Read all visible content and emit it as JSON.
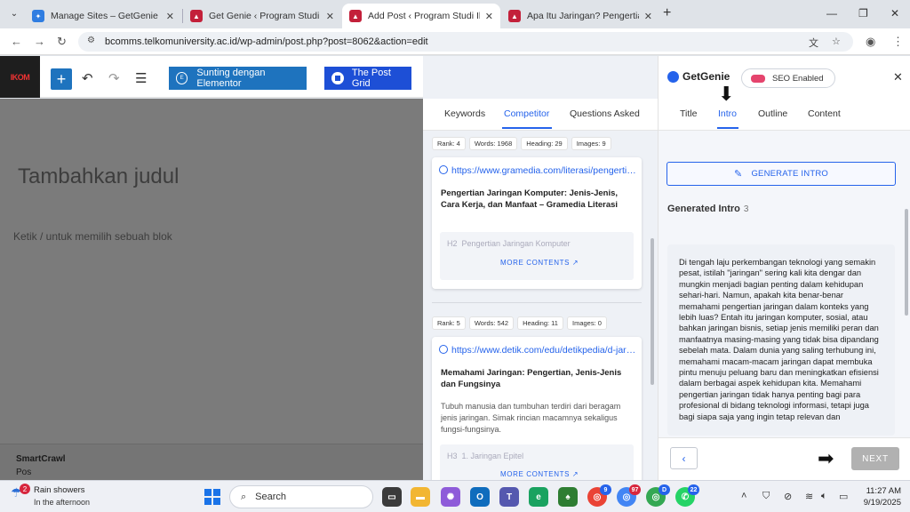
{
  "browser": {
    "tabs": [
      {
        "title": "Manage Sites – GetGenie",
        "icon": "getgenie-favicon"
      },
      {
        "title": "Get Genie ‹ Program Studi Ilmu",
        "icon": "telkom-favicon"
      },
      {
        "title": "Add Post ‹ Program Studi Ilmu",
        "icon": "telkom-favicon"
      },
      {
        "title": "Apa Itu Jaringan? Pengertian, Je",
        "icon": "telkom-favicon"
      }
    ],
    "url": "bcomms.telkomuniversity.ac.id/wp-admin/post.php?post=8062&action=edit"
  },
  "wp_toolbar": {
    "logo_text": "IKOM",
    "add_label": "+",
    "elementor_label": "Sunting dengan Elementor",
    "postgrid_label": "The Post Grid"
  },
  "editor": {
    "title_placeholder": "Tambahkan judul",
    "block_hint": "Ketik / untuk memilih sebuah blok",
    "footer_title": "SmartCrawl",
    "footer_sub": "Pos"
  },
  "competitor_panel": {
    "tabs": [
      "Keywords",
      "Competitor",
      "Questions Asked"
    ],
    "active_tab": "Competitor",
    "results": [
      {
        "stats": [
          "Rank: 4",
          "Words: 1968",
          "Heading: 29",
          "Images: 9"
        ],
        "url": "https://www.gramedia.com/literasi/pengertian-jaringan-komputer/",
        "title": "Pengertian Jaringan Komputer: Jenis-Jenis, Cara Kerja, dan Manfaat – Gramedia Literasi",
        "description": "",
        "heading_tag": "H2",
        "heading": "Pengertian Jaringan Komputer",
        "more": "MORE CONTENTS ↗"
      },
      {
        "stats": [
          "Rank: 5",
          "Words: 542",
          "Heading: 11",
          "Images: 0"
        ],
        "url": "https://www.detik.com/edu/detikpedia/d-jaringan",
        "title": "Memahami Jaringan: Pengertian, Jenis-Jenis dan Fungsinya",
        "description": "Tubuh manusia dan tumbuhan terdiri dari beragam jenis jaringan. Simak rincian macamnya sekaligus fungsi-fungsinya.",
        "heading_tag": "H3",
        "heading": "1. Jaringan Epitel",
        "more": "MORE CONTENTS ↗"
      }
    ]
  },
  "genie_panel": {
    "brand": "GetGenie",
    "seo_label": "SEO Enabled",
    "tabs": [
      "Title",
      "Intro",
      "Outline",
      "Content"
    ],
    "active_tab": "Intro",
    "generate_label": "GENERATE INTRO",
    "generated_heading": "Generated Intro",
    "generated_count": "3",
    "intro_text": "Di tengah laju perkembangan teknologi yang semakin pesat, istilah \"jaringan\" sering kali kita dengar dan mungkin menjadi bagian penting dalam kehidupan sehari-hari. Namun, apakah kita benar-benar memahami pengertian jaringan dalam konteks yang lebih luas? Entah itu jaringan komputer, sosial, atau bahkan jaringan bisnis, setiap jenis memiliki peran dan manfaatnya masing-masing yang tidak bisa dipandang sebelah mata. Dalam dunia yang saling terhubung ini, memahami macam-macam jaringan dapat membuka pintu menuju peluang baru dan meningkatkan efisiensi dalam berbagai aspek kehidupan kita. Memahami pengertian jaringan tidak hanya penting bagi para profesional di bidang teknologi informasi, tetapi juga bagi siapa saja yang ingin tetap relevan dan",
    "next_label": "NEXT",
    "back_icon": "chevron-left-icon"
  },
  "taskbar": {
    "weather_title": "Rain showers",
    "weather_sub": "In the afternoon",
    "weather_badge": "2",
    "search_placeholder": "Search",
    "apps": [
      {
        "name": "chrome-1",
        "badge": "9"
      },
      {
        "name": "chrome-2",
        "badge": "97"
      },
      {
        "name": "chrome-3",
        "badge": "D"
      },
      {
        "name": "whatsapp",
        "badge": "22"
      }
    ],
    "time": "11:27 AM",
    "date": "9/19/2025"
  },
  "colors": {
    "accent": "#2563eb",
    "wp_blue": "#1e73be",
    "next_disabled": "#b1b1b1"
  }
}
